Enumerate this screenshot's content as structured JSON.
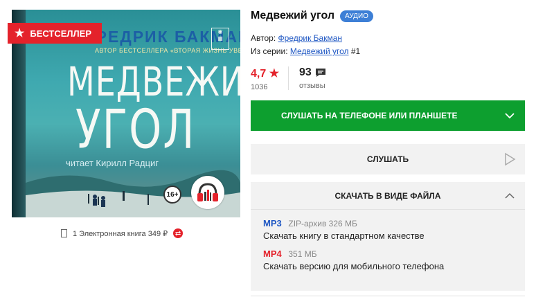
{
  "cover": {
    "author_text": "ФРЕДРИК БАКМАН",
    "subtitle_text": "АВТОР БЕСТСЕЛЛЕРА «ВТОРАЯ ЖИЗНЬ УВЕ»",
    "title_line1": "МЕДВЕЖИЙ",
    "title_line2": "УГОЛ",
    "narrator_text": "читает Кирилл Радциг",
    "age_rating": "16+",
    "bestseller_label": "БЕСТСЕЛЛЕР",
    "colors": {
      "badge_red": "#e4222b",
      "cover_teal": "#3fa9b0"
    }
  },
  "edition": {
    "text": "1 Электронная книга 349 ₽"
  },
  "book": {
    "title": "Медвежий угол",
    "type_badge": "АУДИО",
    "author_label": "Автор:",
    "author_name": "Фредрик Бакман",
    "series_label": "Из серии:",
    "series_name": "Медвежий угол",
    "series_number": "#1"
  },
  "rating": {
    "value": "4,7",
    "votes": "1036",
    "reviews_count": "93",
    "reviews_label": "отзывы"
  },
  "actions": {
    "listen_phone_label": "СЛУШАТЬ НА ТЕЛЕФОНЕ ИЛИ ПЛАНШЕТЕ",
    "listen_label": "СЛУШАТЬ",
    "download_label": "СКАЧАТЬ В ВИДЕ ФАЙЛА",
    "accent_green": "#0d9f2f"
  },
  "formats": [
    {
      "name": "MP3",
      "size": "ZIP-архив 326 МБ",
      "description": "Скачать книгу в стандартном качестве",
      "color": "#1f57c3"
    },
    {
      "name": "MP4",
      "size": "351 МБ",
      "description": "Скачать версию для мобильного телефона",
      "color": "#e4222b"
    }
  ]
}
